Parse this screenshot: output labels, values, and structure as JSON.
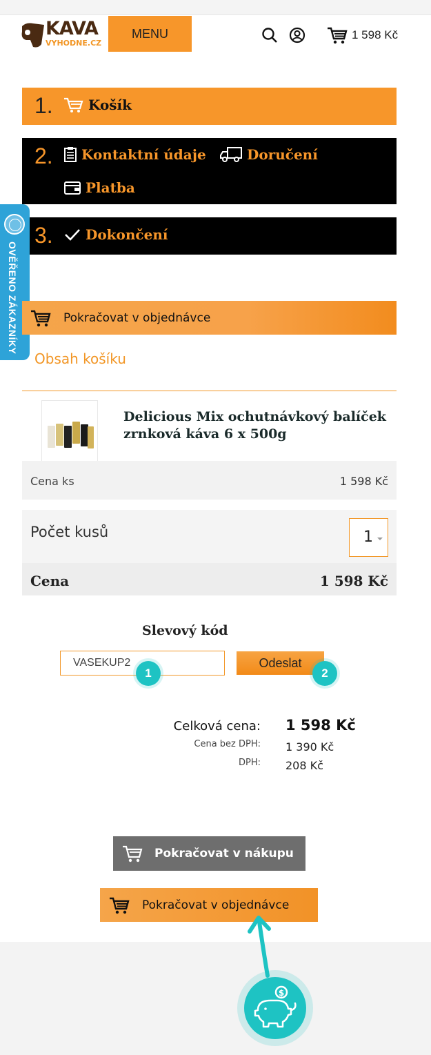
{
  "header": {
    "logo_text": "KAVA",
    "logo_sub": "VYHODNE.CZ",
    "menu_label": "MENU",
    "cart_total": "1 598 Kč"
  },
  "steps": {
    "step1": {
      "number": "1.",
      "label": "Košík"
    },
    "step2": {
      "number": "2.",
      "contact": "Kontaktní údaje",
      "delivery": "Doručení",
      "payment": "Platba"
    },
    "step3": {
      "number": "3.",
      "label": "Dokončení"
    }
  },
  "side_badge": {
    "text": "OVĚŘENO ZÁKAZNÍKY"
  },
  "continue_top": {
    "label": "Pokračovat v objednávce"
  },
  "cart": {
    "title": "Obsah košíku",
    "product_name": "Delicious Mix ochutnávkový balíček zrnková káva 6 x 500g",
    "unit_price_label": "Cena ks",
    "unit_price": "1 598 Kč",
    "qty_label": "Počet kusů",
    "qty": "1",
    "price_label": "Cena",
    "price": "1 598 Kč"
  },
  "discount": {
    "title": "Slevový kód",
    "code_value": "VASEKUP2",
    "submit_label": "Odeslat",
    "marker1": "1",
    "marker2": "2"
  },
  "totals": {
    "total_label": "Celková cena:",
    "total_value": "1 598 Kč",
    "no_vat_label": "Cena bez DPH:",
    "no_vat_value": "1 390 Kč",
    "vat_label": "DPH:",
    "vat_value": "208 Kč"
  },
  "actions": {
    "continue_shopping": "Pokračovat v nákupu",
    "continue_order": "Pokračovat v objednávce"
  },
  "colors": {
    "accent": "#f7962a",
    "teal": "#1ec3c3",
    "badge_blue": "#2ea3d8"
  }
}
